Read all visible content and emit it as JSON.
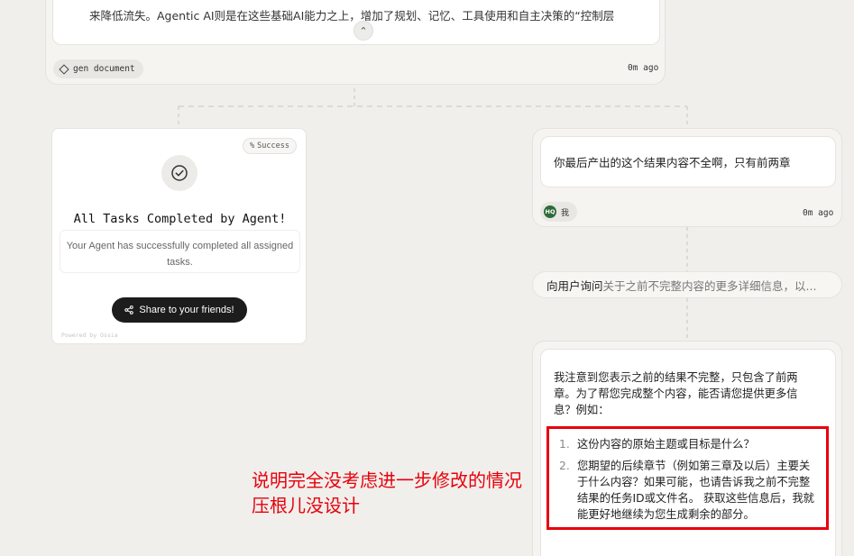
{
  "doc_node": {
    "text": "来降低流失。Agentic AI则是在这些基础AI能力之上，增加了规划、记忆、工具使用和自主决策的“控制层",
    "collapse_glyph": "⌃",
    "tool_label": "gen document",
    "time": "0m ago"
  },
  "success_card": {
    "badge": "Success",
    "badge_glyph": "%",
    "title": "All Tasks Completed by Agent!",
    "description": "Your Agent has successfully completed all assigned tasks.",
    "share_label": "Share to your friends!",
    "powered_by": "Powered by Ossia"
  },
  "user_message": {
    "text": "你最后产出的这个结果内容不全啊，只有前两章",
    "avatar_initials": "HQ",
    "user_label": "我",
    "time": "0m ago"
  },
  "ask_user": {
    "action": "向用户询问",
    "detail": "关于之前不完整内容的更多详细信息，以..."
  },
  "reply": {
    "intro": "我注意到您表示之前的结果不完整，只包含了前两章。为了帮您完成整个内容，能否请您提供更多信息？例如：",
    "items": [
      {
        "num": "1.",
        "text": "这份内容的原始主题或目标是什么？"
      },
      {
        "num": "2.",
        "text": "您期望的后续章节（例如第三章及以后）主要关于什么内容？如果可能，也请告诉我之前不完整结果的任务ID或文件名。 获取这些信息后，我就能更好地继续为您生成剩余的部分。"
      }
    ]
  },
  "annotation": {
    "line1": "说明完全没考虑进一步修改的情况",
    "line2": "压根儿没设计"
  },
  "colors": {
    "annotation_red": "#e8000b",
    "avatar_green": "#2e6b3a",
    "share_button_bg": "#1c1c1c"
  }
}
